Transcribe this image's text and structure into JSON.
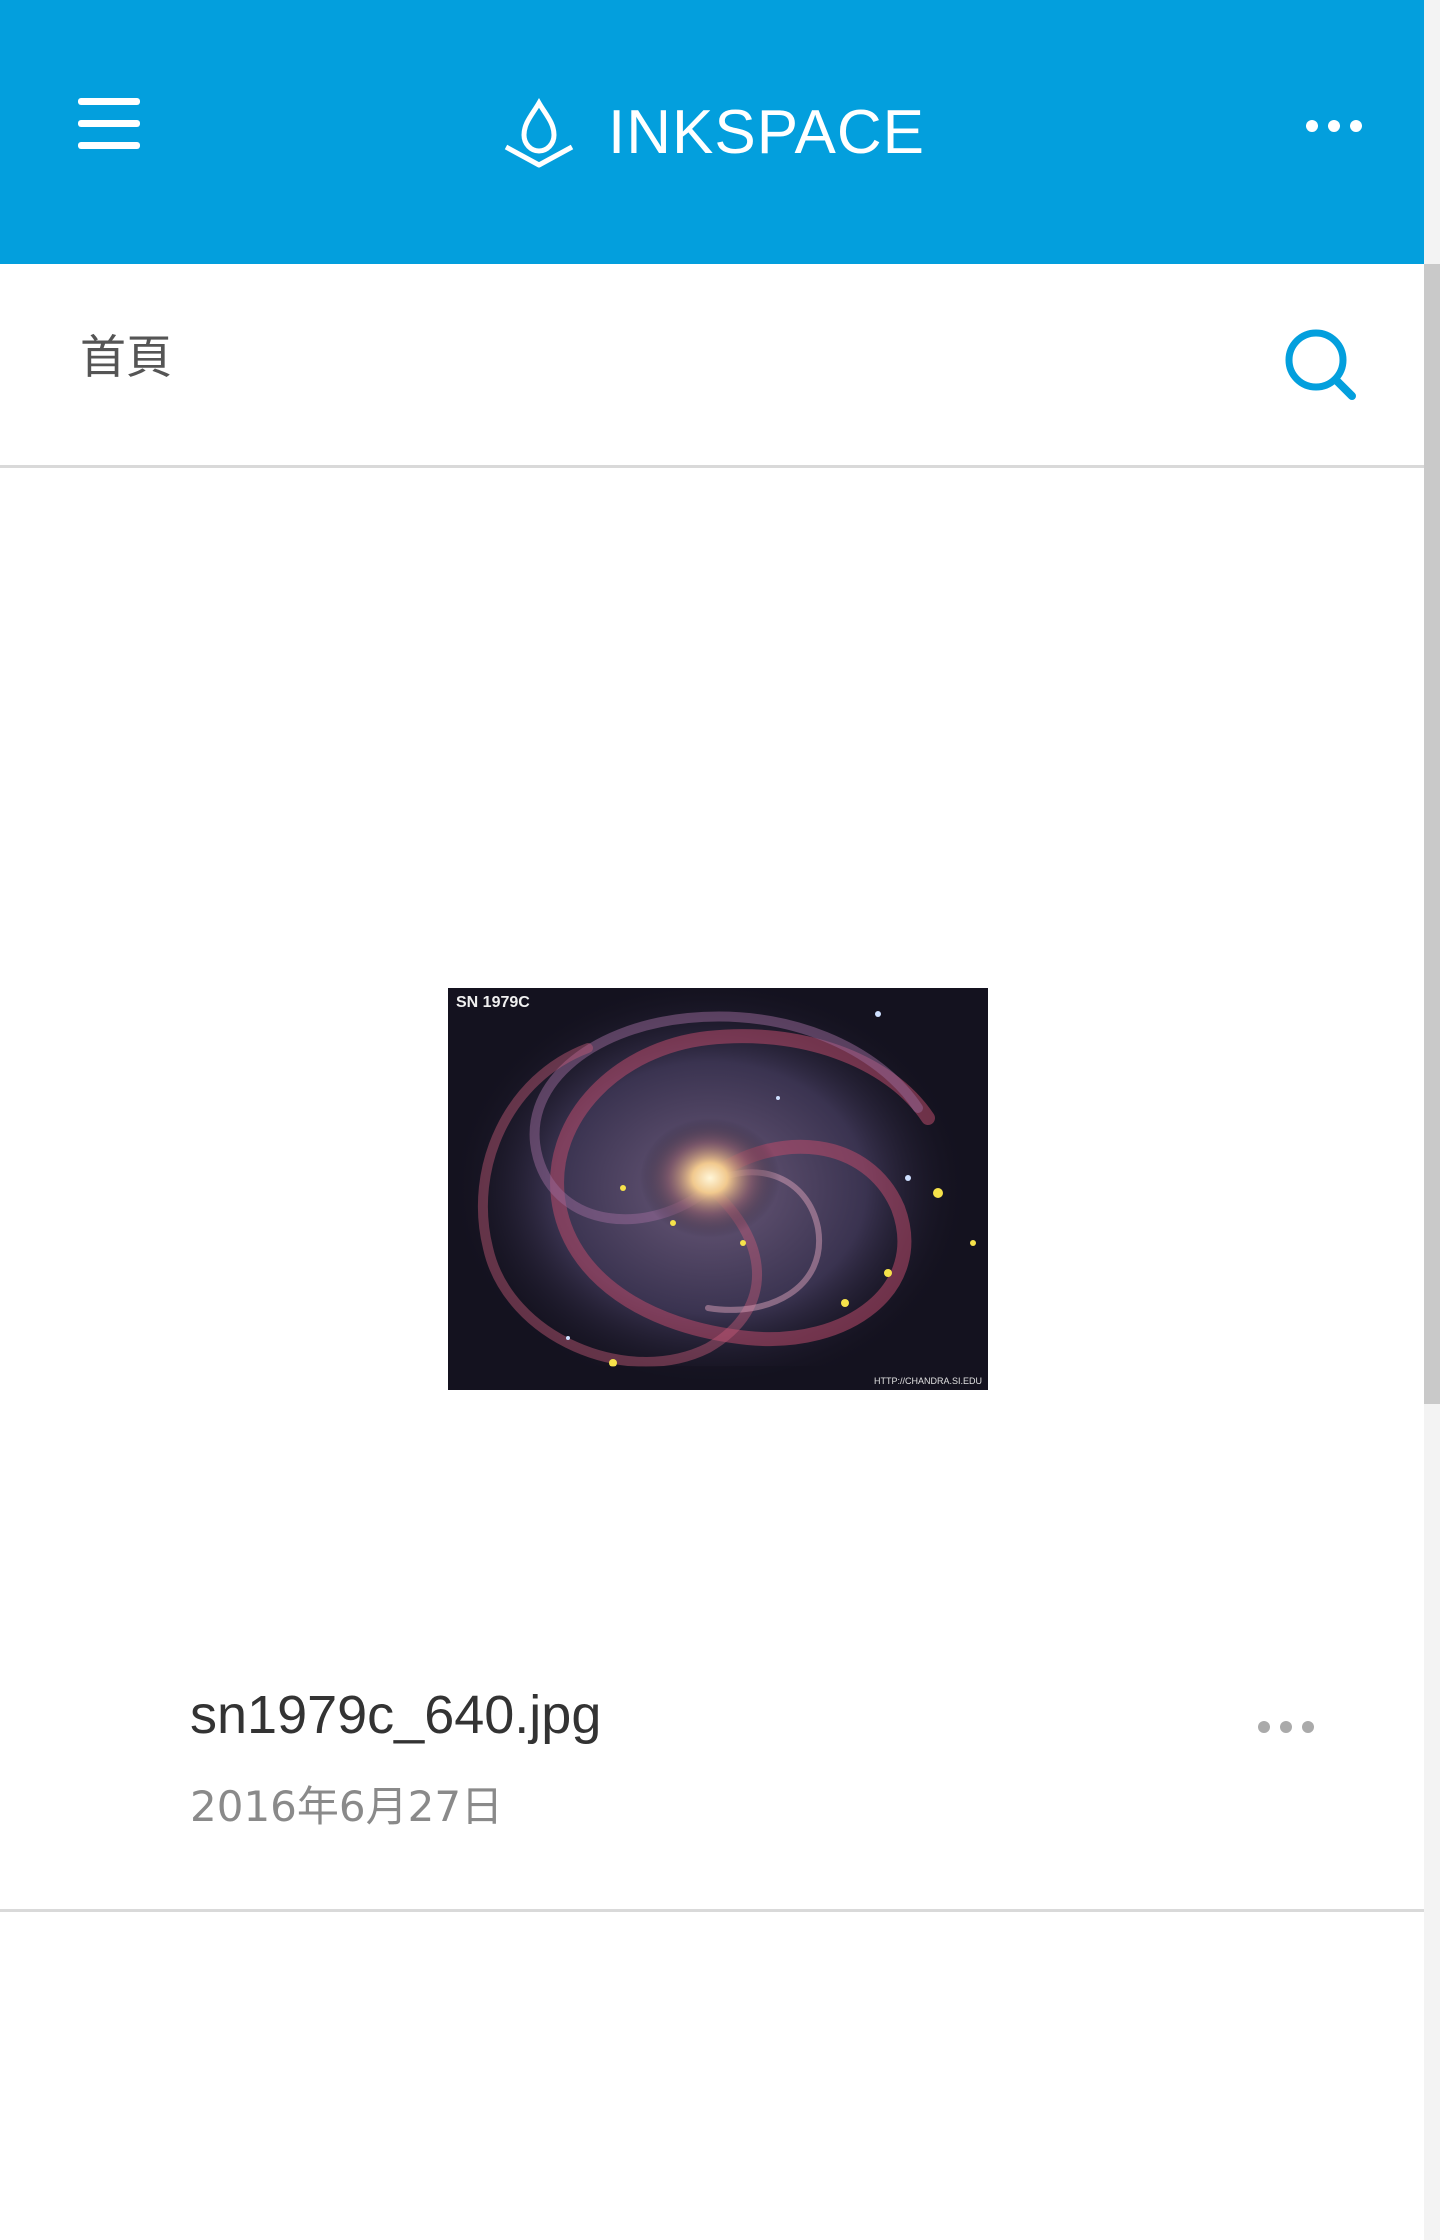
{
  "app": {
    "title": "INKSPACE",
    "accent_color": "#039fdd"
  },
  "header": {
    "menu_icon": "hamburger-menu-icon",
    "logo_icon": "inkspace-drop-icon",
    "more_icon": "more-horizontal-icon"
  },
  "breadcrumb": {
    "label": "首頁",
    "search_icon": "search-icon"
  },
  "items": [
    {
      "file_name": "sn1979c_640.jpg",
      "date": "2016年6月27日",
      "thumbnail_caption": "SN 1979C",
      "thumbnail_credit": "HTTP://CHANDRA.SI.EDU",
      "more_icon": "more-horizontal-icon"
    }
  ]
}
